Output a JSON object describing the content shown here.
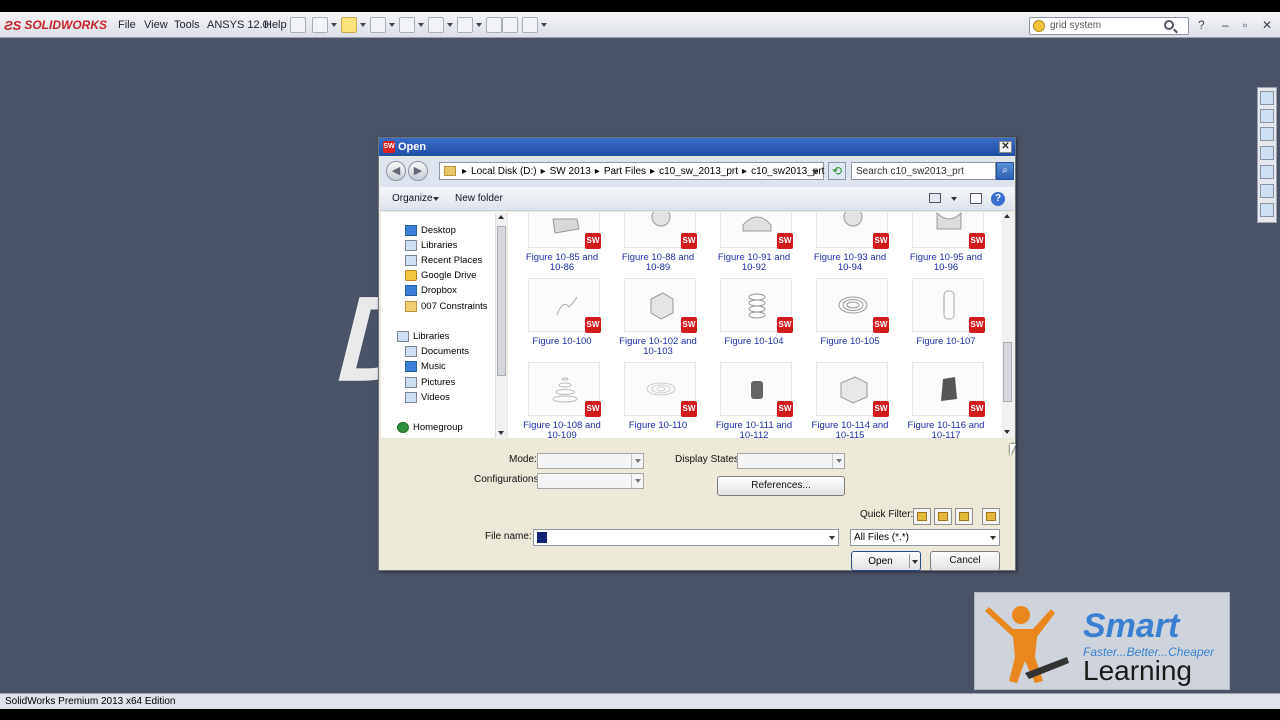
{
  "app": {
    "brand": "SOLIDWORKS",
    "menu": [
      "File",
      "View",
      "Tools",
      "ANSYS 12.0",
      "Help"
    ],
    "search_placeholder": "grid system",
    "status_text": "SolidWorks Premium 2013 x64 Edition"
  },
  "dialog": {
    "title": "Open",
    "address": [
      "Local Disk (D:)",
      "SW 2013",
      "Part Files",
      "c10_sw_2013_prt",
      "c10_sw2013_prt"
    ],
    "search_placeholder": "Search c10_sw2013_prt",
    "organize_label": "Organize",
    "new_folder_label": "New folder",
    "nav": {
      "favorites": [
        "Desktop",
        "Libraries",
        "Recent Places",
        "Google Drive",
        "Dropbox",
        "007 Constraints"
      ],
      "libraries_label": "Libraries",
      "libraries": [
        "Documents",
        "Music",
        "Pictures",
        "Videos"
      ],
      "homegroup": "Homegroup"
    },
    "files": [
      {
        "name": "Figure 10-85 and 10-86",
        "l1": "Figure 10-85 and",
        "l2": "10-86"
      },
      {
        "name": "Figure 10-88 and 10-89",
        "l1": "Figure 10-88 and",
        "l2": "10-89"
      },
      {
        "name": "Figure 10-91 and 10-92",
        "l1": "Figure 10-91 and",
        "l2": "10-92"
      },
      {
        "name": "Figure 10-93 and 10-94",
        "l1": "Figure 10-93 and",
        "l2": "10-94"
      },
      {
        "name": "Figure 10-95 and 10-96",
        "l1": "Figure 10-95 and",
        "l2": "10-96"
      },
      {
        "name": "Figure 10-100",
        "l1": "Figure 10-100",
        "l2": ""
      },
      {
        "name": "Figure 10-102 and 10-103",
        "l1": "Figure 10-102 and",
        "l2": "10-103"
      },
      {
        "name": "Figure 10-104",
        "l1": "Figure 10-104",
        "l2": ""
      },
      {
        "name": "Figure 10-105",
        "l1": "Figure 10-105",
        "l2": ""
      },
      {
        "name": "Figure 10-107",
        "l1": "Figure 10-107",
        "l2": ""
      },
      {
        "name": "Figure 10-108 and 10-109",
        "l1": "Figure 10-108 and",
        "l2": "10-109"
      },
      {
        "name": "Figure 10-110",
        "l1": "Figure 10-110",
        "l2": ""
      },
      {
        "name": "Figure 10-111 and 10-112",
        "l1": "Figure 10-111 and",
        "l2": "10-112"
      },
      {
        "name": "Figure 10-114 and 10-115",
        "l1": "Figure 10-114 and",
        "l2": "10-115"
      },
      {
        "name": "Figure 10-116 and 10-117",
        "l1": "Figure 10-116 and",
        "l2": "10-117"
      }
    ],
    "sw_badge": "SW",
    "mode_label": "Mode:",
    "display_states_label": "Display States:",
    "configurations_label": "Configurations:",
    "references_label": "References...",
    "quick_filter_label": "Quick Filter:",
    "file_name_label": "File name:",
    "file_name_value": "",
    "file_type_value": "All Files (*.*)",
    "open_label": "Open",
    "cancel_label": "Cancel"
  },
  "watermark": {
    "smart": "Smart",
    "tagline": "Faster...Better...Cheaper",
    "learning": "Learning"
  }
}
